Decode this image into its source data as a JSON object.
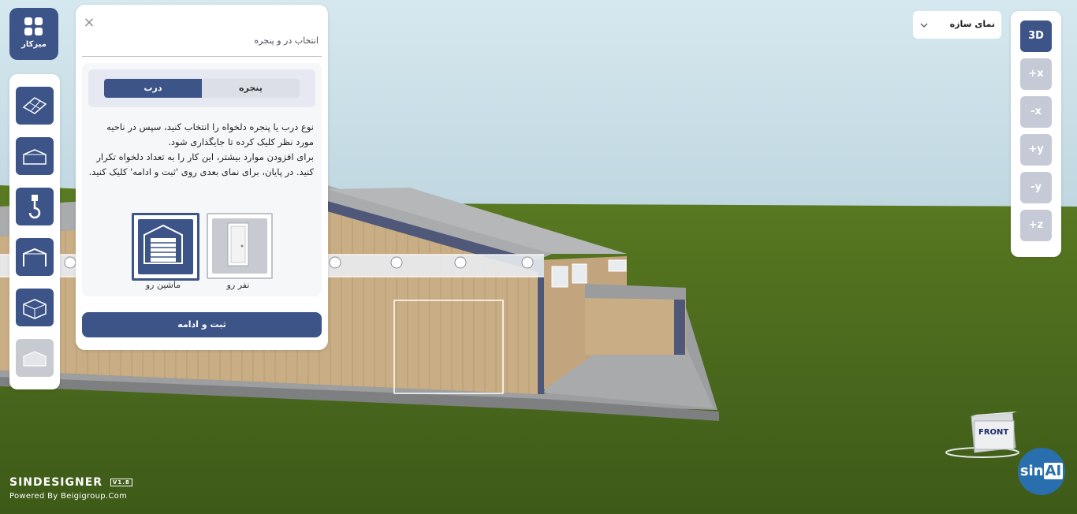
{
  "workspace": {
    "label": "میزکار"
  },
  "tools": [
    {
      "name": "roof-panels-tool",
      "enabled": true
    },
    {
      "name": "shed-tool",
      "enabled": true
    },
    {
      "name": "crane-hook-tool",
      "enabled": true
    },
    {
      "name": "frame-tool",
      "enabled": true
    },
    {
      "name": "building-tool",
      "enabled": true
    },
    {
      "name": "annex-tool",
      "enabled": false
    }
  ],
  "dialog": {
    "close": "×",
    "title": "انتخاب در و پنجره",
    "tabs": {
      "window": "پنجره",
      "door": "درب",
      "active": "door"
    },
    "description": "نوع درب یا پنجره دلخواه را انتخاب کنید، سپس در ناحیه مورد نظر کلیک کرده تا جایگذاری شود.\nبرای افزودن موارد بیشتر، این کار را به تعداد دلخواه تکرار کنید. در پایان، برای نمای بعدی روی 'ثبت و ادامه' کلیک کنید.",
    "options": {
      "pedestrian": "نفر رو",
      "vehicle": "ماشین رو",
      "selected": "vehicle"
    },
    "submit": "ثبت و ادامه"
  },
  "view_select": {
    "value": "نمای سازه",
    "chevron": "chevron-down-icon"
  },
  "axes": [
    "3D",
    "+x",
    "-x",
    "+y",
    "-y",
    "+z"
  ],
  "active_axis": "3D",
  "brand": {
    "logo": "SINDESIGNER",
    "version": "V1.8",
    "powered": "Powered By Beigigroup.Com"
  },
  "assistant": {
    "prefix": "sin",
    "suffix": "AI"
  },
  "view_cube": {
    "label": "FRONT"
  },
  "colors": {
    "accent": "#3d5488",
    "axis_inactive": "#c5cad6",
    "sky": "#cfe3ec",
    "grass": "#4a6a20"
  }
}
